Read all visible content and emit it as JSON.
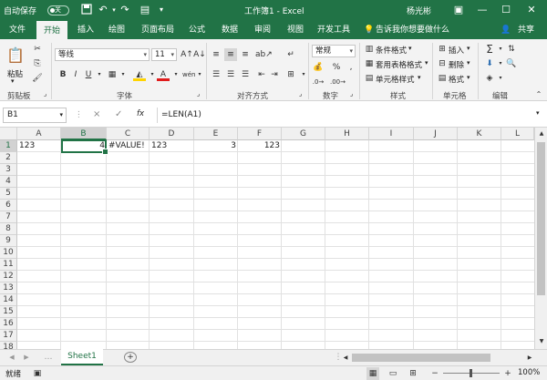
{
  "titlebar": {
    "autosave_label": "自动保存",
    "autosave_state": "关",
    "doc_title": "工作簿1  -  Excel",
    "user": "杨光彬"
  },
  "tabs": [
    "文件",
    "开始",
    "插入",
    "绘图",
    "页面布局",
    "公式",
    "数据",
    "审阅",
    "视图",
    "开发工具"
  ],
  "tell_me": "告诉我你想要做什么",
  "share": "共享",
  "ribbon": {
    "clipboard": {
      "paste": "粘贴",
      "group": "剪贴板"
    },
    "font": {
      "name": "等线",
      "size": "11",
      "bold": "B",
      "italic": "I",
      "underline": "U",
      "group": "字体"
    },
    "alignment": {
      "group": "对齐方式"
    },
    "number": {
      "format": "常规",
      "group": "数字",
      "percent": "%",
      "comma": ","
    },
    "styles": {
      "cond": "条件格式",
      "table": "套用表格格式",
      "cell": "单元格样式",
      "group": "样式"
    },
    "cells": {
      "insert": "插入",
      "delete": "删除",
      "format": "格式",
      "group": "单元格"
    },
    "editing": {
      "group": "编辑"
    }
  },
  "formula_bar": {
    "name_box": "B1",
    "cancel": "×",
    "enter": "✓",
    "fx": "fx",
    "formula": "=LEN(A1)"
  },
  "columns": [
    "A",
    "B",
    "C",
    "D",
    "E",
    "F",
    "G",
    "H",
    "I",
    "J",
    "K",
    "L"
  ],
  "rows": [
    "1",
    "2",
    "3",
    "4",
    "5",
    "6",
    "7",
    "8",
    "9",
    "10",
    "11",
    "12",
    "13",
    "14",
    "15",
    "16",
    "17",
    "18"
  ],
  "cells": {
    "A1": "123",
    "B1": "4",
    "C1": "#VALUE!",
    "D1": "123",
    "E1": "3",
    "F1": "123"
  },
  "sheet_tab": "Sheet1",
  "status": {
    "ready": "就绪",
    "zoom": "100%"
  },
  "colors": {
    "accent": "#217346"
  }
}
